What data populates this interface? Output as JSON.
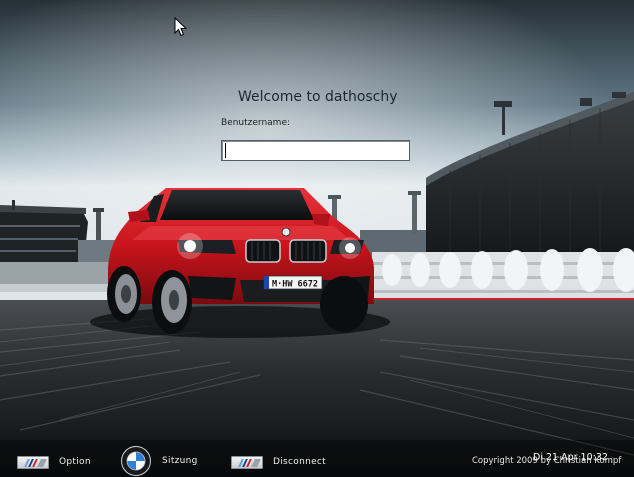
{
  "login": {
    "welcome": "Welcome to dathoschy",
    "username_label": "Benutzername:",
    "username_value": ""
  },
  "bottom_bar": {
    "option_label": "Option",
    "session_label": "Sitzung",
    "disconnect_label": "Disconnect"
  },
  "footer": {
    "copyright": "Copyright 2009 by Christian Kompf",
    "clock": "Di 21 Apr 10:32"
  },
  "car": {
    "plate": "M·HW 6672"
  },
  "icons": {
    "m_badge": "bmw-m-badge-icon",
    "bmw_logo": "bmw-logo-icon",
    "cursor": "mouse-pointer-icon"
  },
  "colors": {
    "car_red": "#c8141c",
    "m_blue_light": "#5aa0e0",
    "m_blue_dark": "#1c3a8a",
    "m_red": "#d21f26"
  }
}
